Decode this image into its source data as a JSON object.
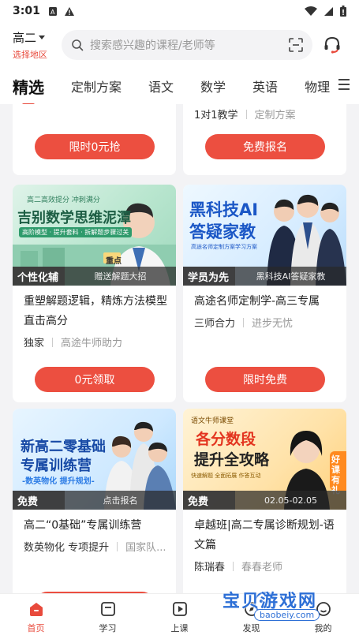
{
  "status": {
    "time": "3:01"
  },
  "header": {
    "grade": "高二",
    "region_label": "选择地区",
    "search_placeholder": "搜索感兴趣的课程/老师等"
  },
  "tabs": [
    {
      "label": "精选"
    },
    {
      "label": "定制方案"
    },
    {
      "label": "语文"
    },
    {
      "label": "数学"
    },
    {
      "label": "英语"
    },
    {
      "label": "物理"
    }
  ],
  "top_cards": [
    {
      "button": "限时0元抢"
    },
    {
      "meta1": "1对1教学",
      "meta2": "定制方案",
      "button": "免费报名"
    }
  ],
  "cards": [
    {
      "banner_label": "个性化辅",
      "banner_sub": "赠送解题大招",
      "banner_art": "吉别数学思维泥潭",
      "banner_art_top": "高二高效提分  冲刺满分",
      "banner_art_sub": "高阶模型 · 提升套料 · 拆解题步骤过关",
      "banner_art_badge": "重点",
      "title": "重塑解题逻辑，精炼方法模型直击高分",
      "meta1": "独家",
      "meta2": "高途牛师助力",
      "button": "0元领取"
    },
    {
      "banner_label": "学员为先",
      "banner_sub": "黑科技AI答疑家教",
      "banner_art": "黑科技AI",
      "banner_art2": "答疑家教",
      "banner_art_sub": "高途名师定制方案学习方案",
      "title": "高途名师定制学-高三专属",
      "meta1": "三师合力",
      "meta2": "进步无忧",
      "button": "限时免费"
    },
    {
      "banner_label": "免费",
      "banner_sub": "点击报名",
      "banner_art": "新高二零基础",
      "banner_art2": "专属训练营",
      "banner_art_sub": "-数英物化 提升规划-",
      "title": "高二“0基础”专属训练营",
      "meta1": "数英物化 专项提升",
      "meta2": "国家队..."
    },
    {
      "banner_label": "免费",
      "banner_sub": "02.05-02.05",
      "banner_art_top": "语文牛师课堂",
      "banner_art": "各分数段",
      "banner_art2": "提升全攻略",
      "banner_art_sub": "快速解题  全面拓展  作答互动",
      "banner_art_badge": "好课有礼",
      "title": "卓越班|高二专属诊断规划-语文篇",
      "meta1": "陈瑞春",
      "meta2": "春春老师"
    }
  ],
  "bottom_nav": [
    {
      "label": "首页"
    },
    {
      "label": "学习"
    },
    {
      "label": "上课"
    },
    {
      "label": "发现"
    },
    {
      "label": "我的"
    }
  ],
  "watermark": {
    "text": "宝贝游戏网",
    "url_text": "baobeiy.com"
  },
  "colors": {
    "accent": "#e84a3c",
    "button": "#ec4f40"
  }
}
